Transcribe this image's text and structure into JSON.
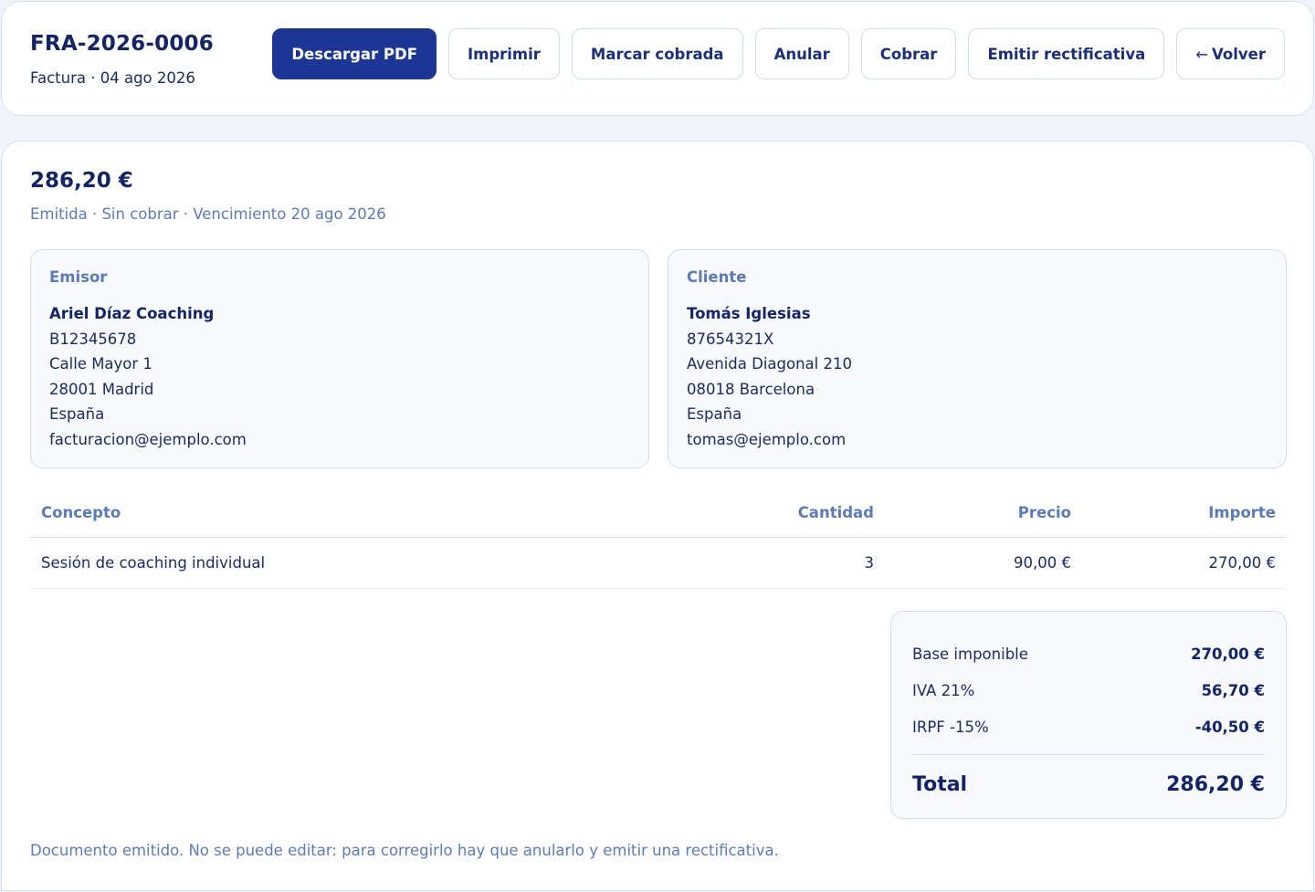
{
  "header": {
    "invoice_number": "FRA-2026-0006",
    "subtitle": "Factura · 04 ago 2026"
  },
  "actions": {
    "download_pdf": "Descargar PDF",
    "print": "Imprimir",
    "mark_paid": "Marcar cobrada",
    "void": "Anular",
    "collect": "Cobrar",
    "rectify": "Emitir rectificativa",
    "back_arrow": "←",
    "back": "Volver"
  },
  "summary": {
    "amount": "286,20 €",
    "status": "Emitida · Sin cobrar · Vencimiento 20 ago 2026"
  },
  "emisor": {
    "label": "Emisor",
    "name": "Ariel Díaz Coaching",
    "tax_id": "B12345678",
    "address": "Calle Mayor 1",
    "city": "28001 Madrid",
    "country": "España",
    "email": "facturacion@ejemplo.com"
  },
  "cliente": {
    "label": "Cliente",
    "name": "Tomás Iglesias",
    "tax_id": "87654321X",
    "address": "Avenida Diagonal 210",
    "city": "08018 Barcelona",
    "country": "España",
    "email": "tomas@ejemplo.com"
  },
  "table": {
    "headers": {
      "concepto": "Concepto",
      "cantidad": "Cantidad",
      "precio": "Precio",
      "importe": "Importe"
    },
    "rows": [
      {
        "concepto": "Sesión de coaching individual",
        "cantidad": "3",
        "precio": "90,00 €",
        "importe": "270,00 €"
      }
    ]
  },
  "totals": {
    "base_label": "Base imponible",
    "base_value": "270,00 €",
    "iva_label": "IVA 21%",
    "iva_value": "56,70 €",
    "irpf_label": "IRPF -15%",
    "irpf_value": "-40,50 €",
    "total_label": "Total",
    "total_value": "286,20 €"
  },
  "footnote": "Documento emitido. No se puede editar: para corregirlo hay que anularlo y emitir una rectificativa.",
  "colors": {
    "primary": "#1d3695",
    "heading": "#142466",
    "muted": "#5d7ab8",
    "border": "#d3dbeb"
  }
}
